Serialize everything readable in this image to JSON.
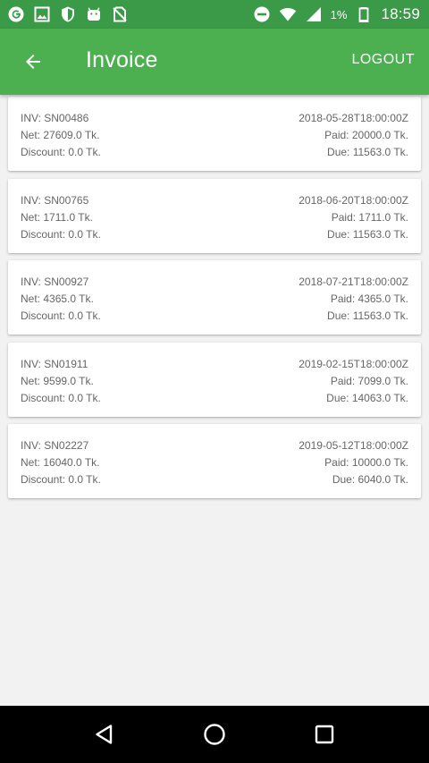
{
  "status_bar": {
    "battery_text": "1%",
    "time": "18:59",
    "left_icons": [
      "google-icon",
      "gallery-icon",
      "shield-icon",
      "android-icon",
      "no-sim-icon"
    ],
    "right_icons": [
      "dnd-icon",
      "wifi-icon",
      "signal-icon",
      "battery-icon"
    ]
  },
  "app_bar": {
    "title": "Invoice",
    "logout_label": "LOGOUT",
    "color": "#4caf50",
    "status_color": "#3b9a48"
  },
  "invoices": [
    {
      "inv": "INV: SN00486",
      "date": "2018-05-28T18:00:00Z",
      "net": "Net: 27609.0 Tk.",
      "paid": "Paid: 20000.0 Tk.",
      "discount": "Discount: 0.0 Tk.",
      "due": "Due: 11563.0 Tk."
    },
    {
      "inv": "INV: SN00765",
      "date": "2018-06-20T18:00:00Z",
      "net": "Net: 1711.0 Tk.",
      "paid": "Paid: 1711.0 Tk.",
      "discount": "Discount: 0.0 Tk.",
      "due": "Due: 11563.0 Tk."
    },
    {
      "inv": "INV: SN00927",
      "date": "2018-07-21T18:00:00Z",
      "net": "Net: 4365.0 Tk.",
      "paid": "Paid: 4365.0 Tk.",
      "discount": "Discount: 0.0 Tk.",
      "due": "Due: 11563.0 Tk."
    },
    {
      "inv": "INV: SN01911",
      "date": "2019-02-15T18:00:00Z",
      "net": "Net: 9599.0 Tk.",
      "paid": "Paid: 7099.0 Tk.",
      "discount": "Discount: 0.0 Tk.",
      "due": "Due: 14063.0 Tk."
    },
    {
      "inv": "INV: SN02227",
      "date": "2019-05-12T18:00:00Z",
      "net": "Net: 16040.0 Tk.",
      "paid": "Paid: 10000.0 Tk.",
      "discount": "Discount: 0.0 Tk.",
      "due": "Due: 6040.0 Tk."
    }
  ],
  "nav_bar": {
    "icons": [
      "back-triangle-icon",
      "home-circle-icon",
      "recents-square-icon"
    ]
  }
}
